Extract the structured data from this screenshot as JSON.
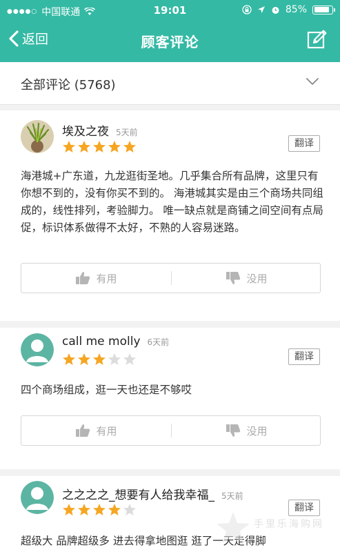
{
  "status": {
    "carrier": "中国联通",
    "time": "19:01",
    "battery": "85%",
    "battery_level": 0.85
  },
  "nav": {
    "back_label": "返回",
    "title": "顾客评论"
  },
  "filter": {
    "label": "全部评论 (5768)"
  },
  "reviews": [
    {
      "name": "埃及之夜",
      "time": "5天前",
      "rating": 5,
      "translate": "翻译",
      "text": "海港城+广东道，九龙逛街圣地。几乎集合所有品牌，这里只有你想不到的，没有你买不到的。 海港城其实是由三个商场共同组成的，线性排列，考验脚力。 唯一缺点就是商铺之间空间有点局促，标识体系做得不太好，不熟的人容易迷路。",
      "useful": "有用",
      "useless": "没用"
    },
    {
      "name": "call me molly",
      "time": "6天前",
      "rating": 3,
      "translate": "翻译",
      "text": "四个商场组成，逛一天也还是不够哎",
      "useful": "有用",
      "useless": "没用"
    },
    {
      "name": "之之之之_想要有人给我幸福_",
      "time": "5天前",
      "rating": 4,
      "translate": "翻译",
      "text": "超级大 品牌超级多 进去得拿地图逛 逛了一天走得脚"
    }
  ],
  "watermark": "手里乐海购网",
  "colors": {
    "header": "#34b9a4",
    "star_on": "#f5a623",
    "star_off": "#dcdcdc"
  }
}
